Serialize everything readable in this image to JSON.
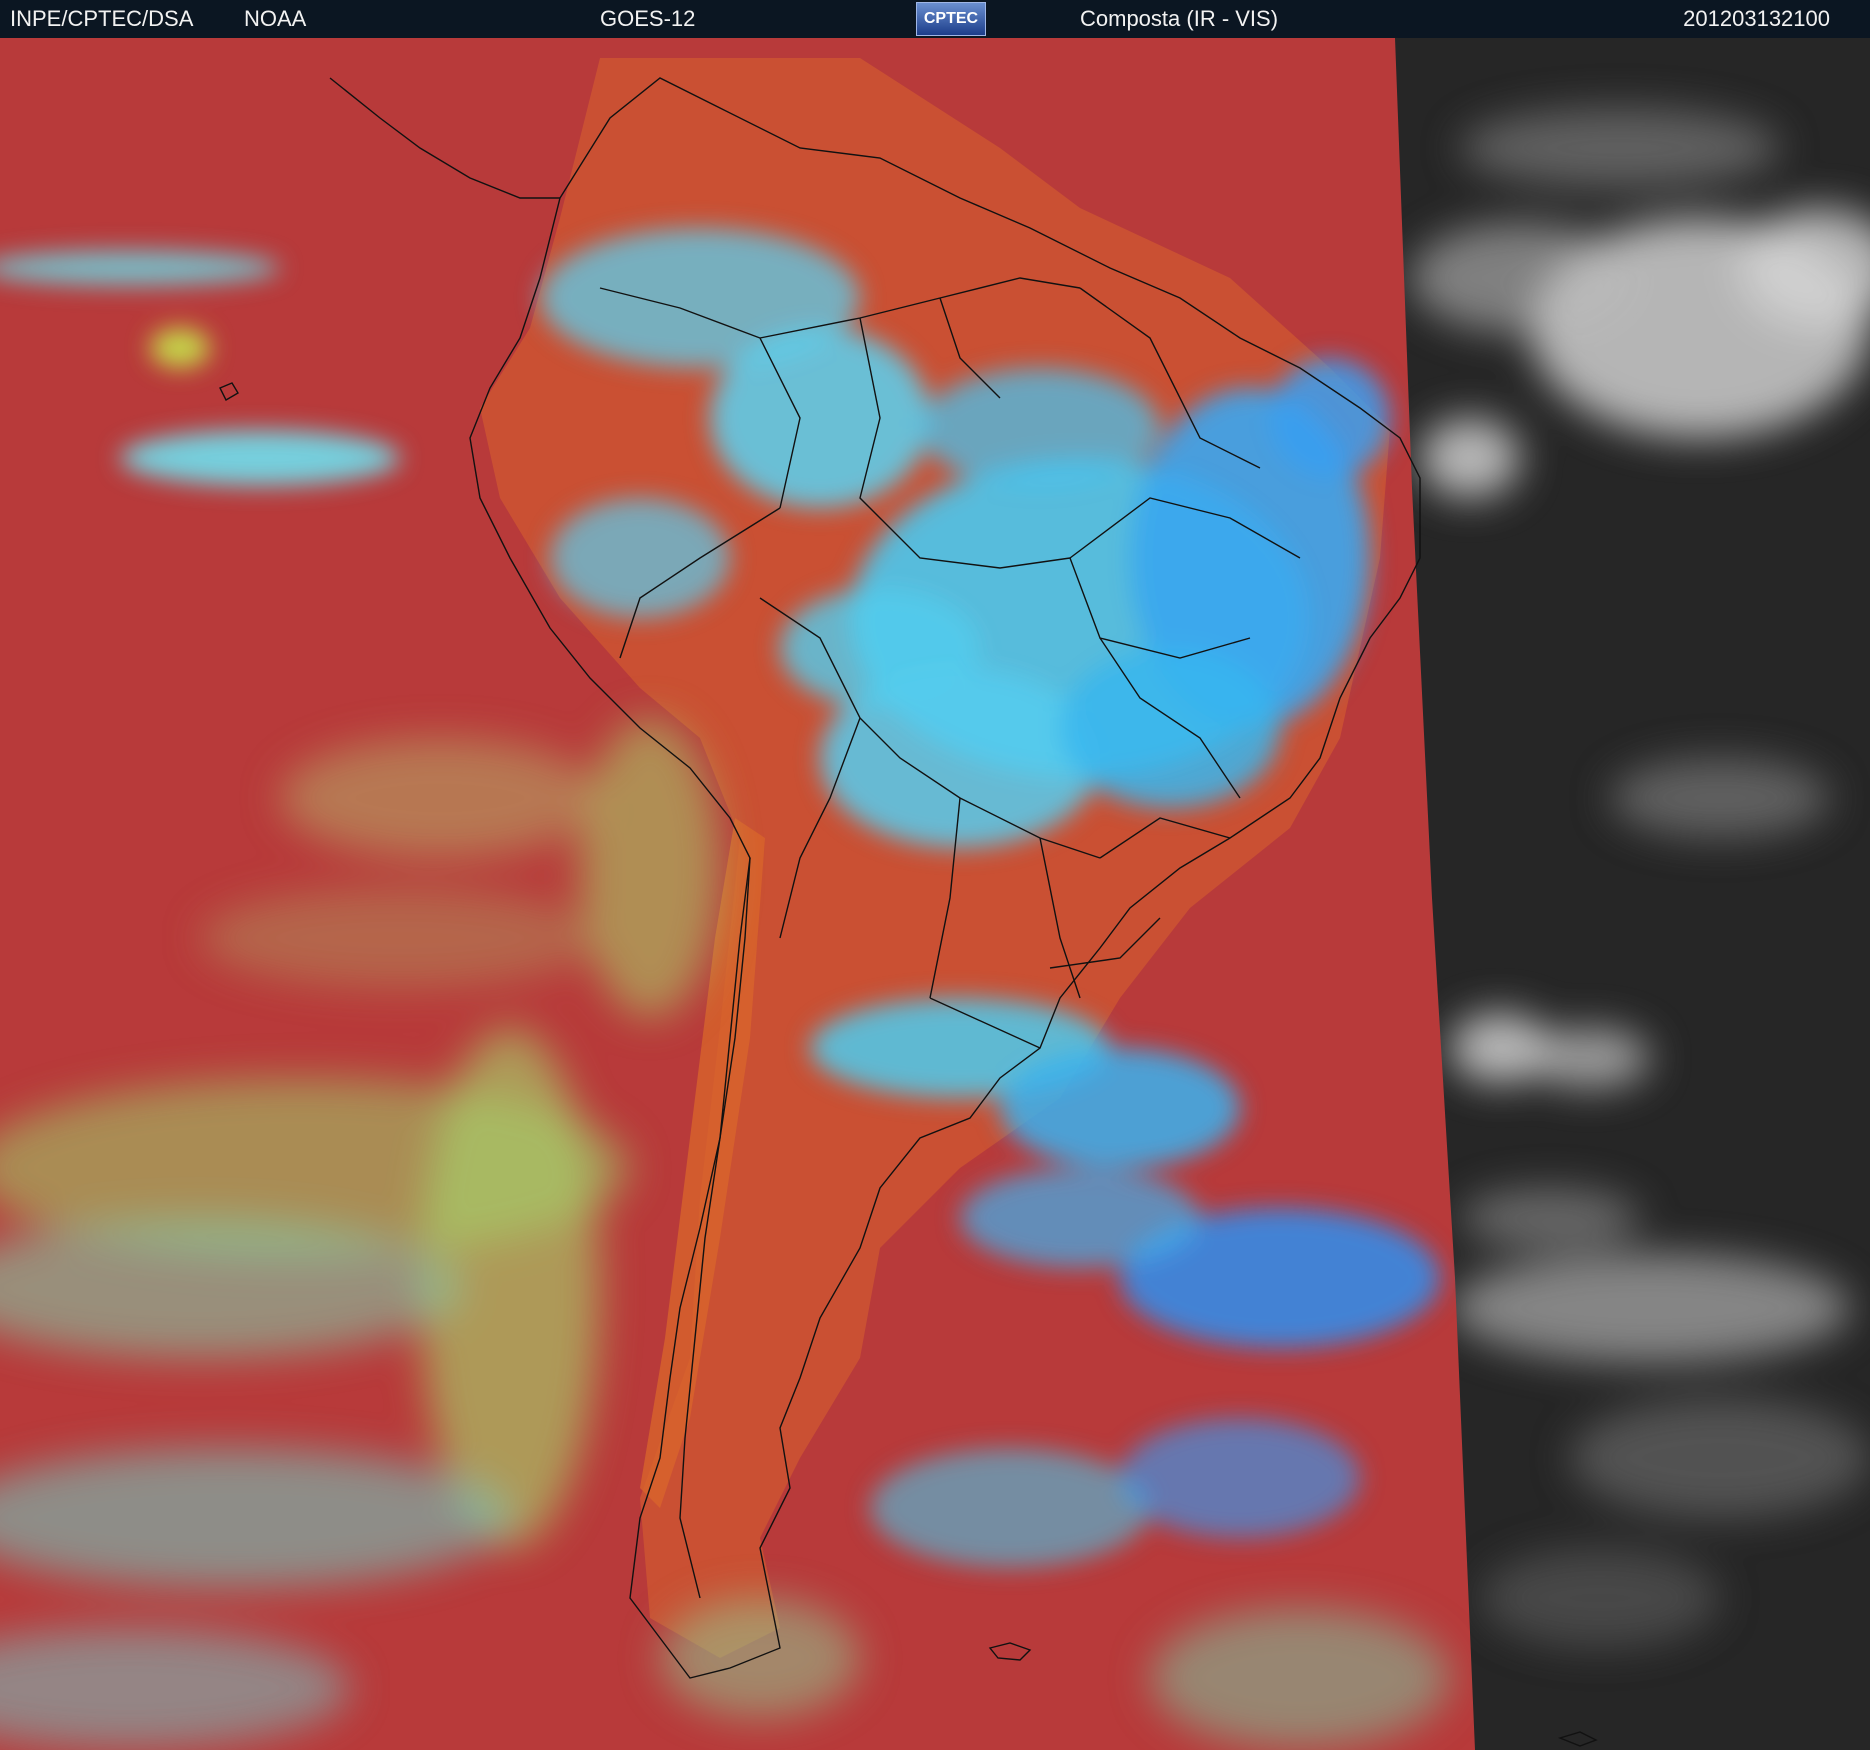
{
  "header": {
    "agency": "INPE/CPTEC/DSA",
    "partner": "NOAA",
    "satellite": "GOES-12",
    "logo_text": "CPTEC",
    "product": "Composta (IR - VIS)",
    "timestamp": "201203132100"
  },
  "colors": {
    "header_bg": "#0b1622",
    "ocean_ir": "#b83a3a",
    "land_ir": "#cf5a30",
    "cold_cloud": "#3fc8ee",
    "mid_cloud": "#a8d76a",
    "vis_background": "#262626",
    "vis_cloud": "#d8d8d8"
  }
}
